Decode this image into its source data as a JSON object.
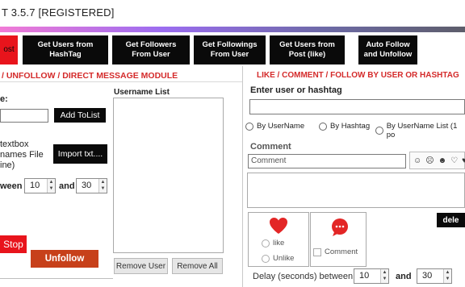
{
  "window": {
    "title": "T 3.5.7 [REGISTERED]"
  },
  "toolbar": {
    "red_label": "ost",
    "buttons": [
      "Get Users from HashTag",
      "Get Followers From User",
      "Get Followings From User",
      "Get Users from Post (like)",
      "Auto Follow and Unfollow"
    ]
  },
  "left": {
    "heading": "/ UNFOLLOW / DIRECT MESSAGE MODULE",
    "username_label": "e:",
    "add_to_list": "Add ToList",
    "textbox_line1": "textbox",
    "textbox_line2": "names File",
    "textbox_line3": "ine)",
    "import_txt": "Import txt....",
    "between_label": "ween",
    "delay_min": "10",
    "and_label": "and",
    "delay_max": "30",
    "stop": "Stop",
    "unfollow": "Unfollow",
    "username_list_label": "Username List",
    "remove_user": "Remove User",
    "remove_all": "Remove All"
  },
  "right": {
    "heading": "LIKE / COMMENT / FOLLOW BY USER OR HASHTAG",
    "enter_label": "Enter user or hashtag",
    "radio_username": "By UserName",
    "radio_hashtag": "By Hashtag",
    "radio_list": "By UserName List (1 po",
    "comment_label": "Comment",
    "comment_value": "Comment",
    "emoji_icons": [
      "smile-face-icon",
      "frown-face-icon",
      "dark-face-icon",
      "heart-outline-icon",
      "heart-icon"
    ],
    "delete": "dele",
    "like": "like",
    "unlike": "Unlike",
    "comment_check": "Comment",
    "delay_label": "Delay (seconds) between:",
    "delay_min": "10",
    "and_label": "and",
    "delay_max": "30"
  }
}
